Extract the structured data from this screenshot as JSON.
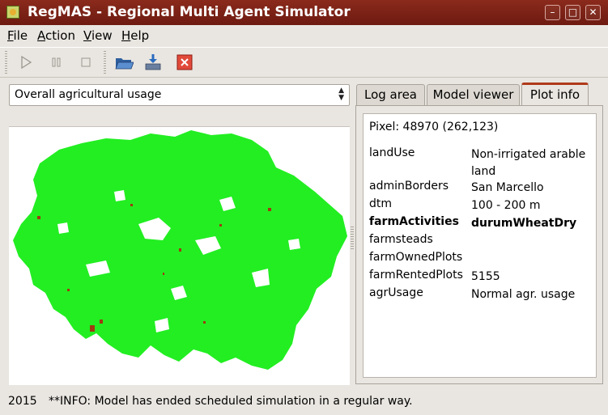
{
  "window": {
    "title": "RegMAS - Regional Multi Agent Simulator",
    "controls": [
      "minimize-icon",
      "maximize-icon",
      "close-icon"
    ]
  },
  "menu": {
    "items": [
      {
        "label": "File",
        "mnemonic": "F"
      },
      {
        "label": "Action",
        "mnemonic": "A"
      },
      {
        "label": "View",
        "mnemonic": "V"
      },
      {
        "label": "Help",
        "mnemonic": "H"
      }
    ]
  },
  "toolbar": {
    "buttons": [
      "play-icon",
      "pause-icon",
      "stop-icon",
      "open-folder-icon",
      "save-icon",
      "exit-icon"
    ]
  },
  "layer_select": {
    "selected": "Overall agricultural usage"
  },
  "tabs": [
    {
      "label": "Log area",
      "active": false
    },
    {
      "label": "Model viewer",
      "active": false
    },
    {
      "label": "Plot info",
      "active": true
    }
  ],
  "plot_info": {
    "pixel": "Pixel: 48970 (262,123)",
    "rows": [
      {
        "key": "landUse",
        "value": "Non-irrigated arable land",
        "bold": false
      },
      {
        "key": "adminBorders",
        "value": "San Marcello",
        "bold": false
      },
      {
        "key": "dtm",
        "value": "100 - 200 m",
        "bold": false
      },
      {
        "key": "farmActivities",
        "value": "durumWheatDry",
        "bold": true
      },
      {
        "key": "farmsteads",
        "value": "",
        "bold": false
      },
      {
        "key": "farmOwnedPlots",
        "value": "",
        "bold": false
      },
      {
        "key": "farmRentedPlots",
        "value": "5155",
        "bold": false
      },
      {
        "key": "agrUsage",
        "value": "Normal agr. usage",
        "bold": false
      }
    ]
  },
  "status": {
    "year": "2015",
    "message": "**INFO: Model has ended scheduled simulation in a regular way."
  },
  "colors": {
    "titlebar": "#7a2216",
    "map_land": "#22ee22",
    "map_highlight": "#a03a10",
    "active_tab": "#b03a1a"
  }
}
